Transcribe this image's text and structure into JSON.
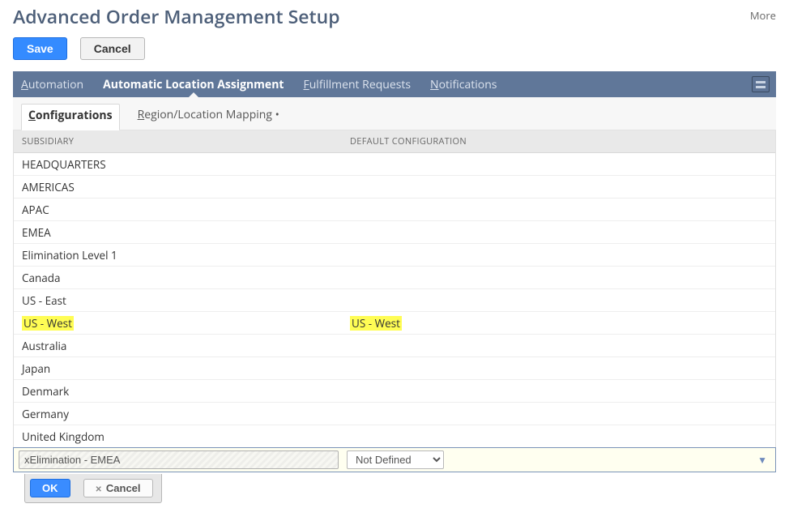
{
  "header": {
    "title": "Advanced Order Management Setup",
    "more": "More"
  },
  "toolbar": {
    "save": "Save",
    "cancel": "Cancel"
  },
  "tabs": [
    {
      "label": "Automation",
      "mn": "A",
      "rest": "utomation",
      "active": false
    },
    {
      "label": "Automatic Location Assignment",
      "mn": "",
      "rest": "Automatic Location Assignment",
      "active": true
    },
    {
      "label": "Fulfillment Requests",
      "mn": "F",
      "rest": "ulfillment Requests",
      "active": false
    },
    {
      "label": "Notifications",
      "mn": "N",
      "rest": "otifications",
      "active": false
    }
  ],
  "subtabs": [
    {
      "label": "Configurations",
      "mn": "C",
      "rest": "onfigurations",
      "active": true
    },
    {
      "label": "Region/Location Mapping •",
      "mn": "R",
      "rest": "egion/Location Mapping •",
      "active": false
    }
  ],
  "columns": {
    "subsidiary": "SUBSIDIARY",
    "default_config": "DEFAULT CONFIGURATION"
  },
  "rows": [
    {
      "subsidiary": "HEADQUARTERS",
      "default": "",
      "hl": false
    },
    {
      "subsidiary": "AMERICAS",
      "default": "",
      "hl": false
    },
    {
      "subsidiary": "APAC",
      "default": "",
      "hl": false
    },
    {
      "subsidiary": "EMEA",
      "default": "",
      "hl": false
    },
    {
      "subsidiary": "Elimination Level 1",
      "default": "",
      "hl": false
    },
    {
      "subsidiary": "Canada",
      "default": "",
      "hl": false
    },
    {
      "subsidiary": "US - East",
      "default": "",
      "hl": false
    },
    {
      "subsidiary": "US - West",
      "default": "US - West",
      "hl": true
    },
    {
      "subsidiary": "Australia",
      "default": "",
      "hl": false
    },
    {
      "subsidiary": "Japan",
      "default": "",
      "hl": false
    },
    {
      "subsidiary": "Denmark",
      "default": "",
      "hl": false
    },
    {
      "subsidiary": "Germany",
      "default": "",
      "hl": false
    },
    {
      "subsidiary": "United Kingdom",
      "default": "",
      "hl": false
    }
  ],
  "edit_row": {
    "subsidiary_value": "xElimination - EMEA",
    "default_value": "Not Defined"
  },
  "row_actions": {
    "ok": "OK",
    "cancel": "Cancel"
  }
}
